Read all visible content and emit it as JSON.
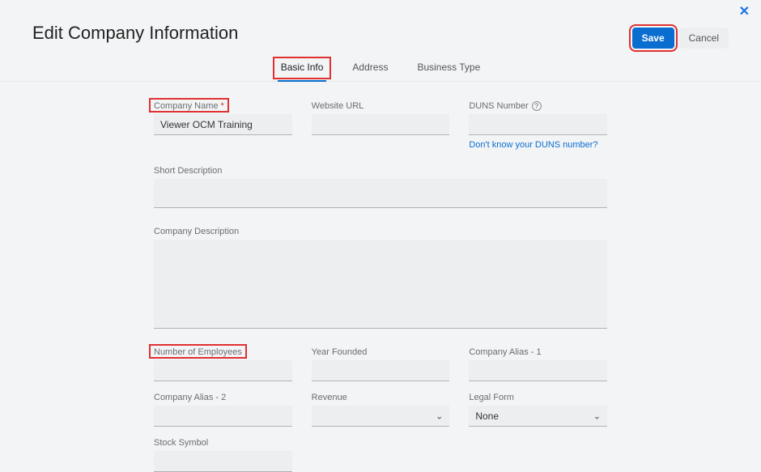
{
  "header": {
    "title": "Edit Company Information",
    "save_label": "Save",
    "cancel_label": "Cancel"
  },
  "tabs": {
    "basic": "Basic Info",
    "address": "Address",
    "business": "Business Type"
  },
  "fields": {
    "company_name": {
      "label": "Company Name",
      "value": "Viewer OCM Training"
    },
    "website": {
      "label": "Website URL",
      "value": ""
    },
    "duns": {
      "label": "DUNS Number",
      "value": "",
      "help_link": "Don't know your DUNS number?"
    },
    "short_desc": {
      "label": "Short Description",
      "value": ""
    },
    "company_desc": {
      "label": "Company Description",
      "value": ""
    },
    "employees": {
      "label": "Number of Employees",
      "value": ""
    },
    "year_founded": {
      "label": "Year Founded",
      "value": ""
    },
    "alias1": {
      "label": "Company Alias - 1",
      "value": ""
    },
    "alias2": {
      "label": "Company Alias - 2",
      "value": ""
    },
    "revenue": {
      "label": "Revenue",
      "value": ""
    },
    "legal_form": {
      "label": "Legal Form",
      "value": "None"
    },
    "stock": {
      "label": "Stock Symbol",
      "value": ""
    }
  }
}
